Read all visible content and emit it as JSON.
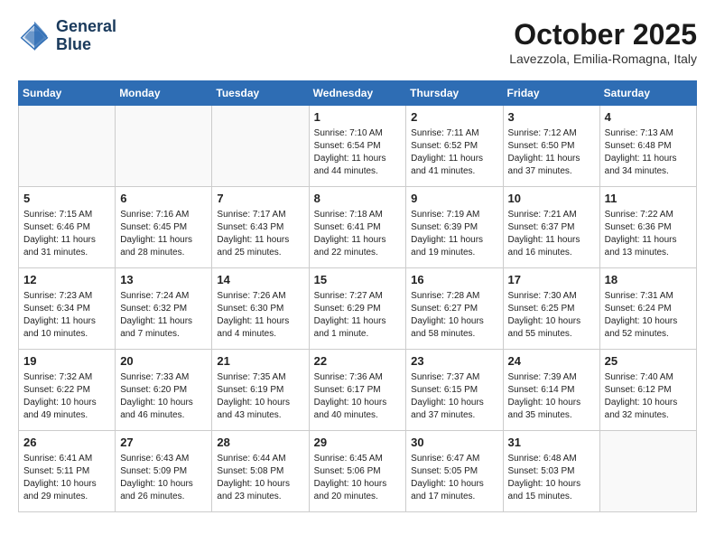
{
  "header": {
    "logo_line1": "General",
    "logo_line2": "Blue",
    "month_title": "October 2025",
    "location": "Lavezzola, Emilia-Romagna, Italy"
  },
  "days_of_week": [
    "Sunday",
    "Monday",
    "Tuesday",
    "Wednesday",
    "Thursday",
    "Friday",
    "Saturday"
  ],
  "weeks": [
    [
      {
        "day": "",
        "info": ""
      },
      {
        "day": "",
        "info": ""
      },
      {
        "day": "",
        "info": ""
      },
      {
        "day": "1",
        "info": "Sunrise: 7:10 AM\nSunset: 6:54 PM\nDaylight: 11 hours and 44 minutes."
      },
      {
        "day": "2",
        "info": "Sunrise: 7:11 AM\nSunset: 6:52 PM\nDaylight: 11 hours and 41 minutes."
      },
      {
        "day": "3",
        "info": "Sunrise: 7:12 AM\nSunset: 6:50 PM\nDaylight: 11 hours and 37 minutes."
      },
      {
        "day": "4",
        "info": "Sunrise: 7:13 AM\nSunset: 6:48 PM\nDaylight: 11 hours and 34 minutes."
      }
    ],
    [
      {
        "day": "5",
        "info": "Sunrise: 7:15 AM\nSunset: 6:46 PM\nDaylight: 11 hours and 31 minutes."
      },
      {
        "day": "6",
        "info": "Sunrise: 7:16 AM\nSunset: 6:45 PM\nDaylight: 11 hours and 28 minutes."
      },
      {
        "day": "7",
        "info": "Sunrise: 7:17 AM\nSunset: 6:43 PM\nDaylight: 11 hours and 25 minutes."
      },
      {
        "day": "8",
        "info": "Sunrise: 7:18 AM\nSunset: 6:41 PM\nDaylight: 11 hours and 22 minutes."
      },
      {
        "day": "9",
        "info": "Sunrise: 7:19 AM\nSunset: 6:39 PM\nDaylight: 11 hours and 19 minutes."
      },
      {
        "day": "10",
        "info": "Sunrise: 7:21 AM\nSunset: 6:37 PM\nDaylight: 11 hours and 16 minutes."
      },
      {
        "day": "11",
        "info": "Sunrise: 7:22 AM\nSunset: 6:36 PM\nDaylight: 11 hours and 13 minutes."
      }
    ],
    [
      {
        "day": "12",
        "info": "Sunrise: 7:23 AM\nSunset: 6:34 PM\nDaylight: 11 hours and 10 minutes."
      },
      {
        "day": "13",
        "info": "Sunrise: 7:24 AM\nSunset: 6:32 PM\nDaylight: 11 hours and 7 minutes."
      },
      {
        "day": "14",
        "info": "Sunrise: 7:26 AM\nSunset: 6:30 PM\nDaylight: 11 hours and 4 minutes."
      },
      {
        "day": "15",
        "info": "Sunrise: 7:27 AM\nSunset: 6:29 PM\nDaylight: 11 hours and 1 minute."
      },
      {
        "day": "16",
        "info": "Sunrise: 7:28 AM\nSunset: 6:27 PM\nDaylight: 10 hours and 58 minutes."
      },
      {
        "day": "17",
        "info": "Sunrise: 7:30 AM\nSunset: 6:25 PM\nDaylight: 10 hours and 55 minutes."
      },
      {
        "day": "18",
        "info": "Sunrise: 7:31 AM\nSunset: 6:24 PM\nDaylight: 10 hours and 52 minutes."
      }
    ],
    [
      {
        "day": "19",
        "info": "Sunrise: 7:32 AM\nSunset: 6:22 PM\nDaylight: 10 hours and 49 minutes."
      },
      {
        "day": "20",
        "info": "Sunrise: 7:33 AM\nSunset: 6:20 PM\nDaylight: 10 hours and 46 minutes."
      },
      {
        "day": "21",
        "info": "Sunrise: 7:35 AM\nSunset: 6:19 PM\nDaylight: 10 hours and 43 minutes."
      },
      {
        "day": "22",
        "info": "Sunrise: 7:36 AM\nSunset: 6:17 PM\nDaylight: 10 hours and 40 minutes."
      },
      {
        "day": "23",
        "info": "Sunrise: 7:37 AM\nSunset: 6:15 PM\nDaylight: 10 hours and 37 minutes."
      },
      {
        "day": "24",
        "info": "Sunrise: 7:39 AM\nSunset: 6:14 PM\nDaylight: 10 hours and 35 minutes."
      },
      {
        "day": "25",
        "info": "Sunrise: 7:40 AM\nSunset: 6:12 PM\nDaylight: 10 hours and 32 minutes."
      }
    ],
    [
      {
        "day": "26",
        "info": "Sunrise: 6:41 AM\nSunset: 5:11 PM\nDaylight: 10 hours and 29 minutes."
      },
      {
        "day": "27",
        "info": "Sunrise: 6:43 AM\nSunset: 5:09 PM\nDaylight: 10 hours and 26 minutes."
      },
      {
        "day": "28",
        "info": "Sunrise: 6:44 AM\nSunset: 5:08 PM\nDaylight: 10 hours and 23 minutes."
      },
      {
        "day": "29",
        "info": "Sunrise: 6:45 AM\nSunset: 5:06 PM\nDaylight: 10 hours and 20 minutes."
      },
      {
        "day": "30",
        "info": "Sunrise: 6:47 AM\nSunset: 5:05 PM\nDaylight: 10 hours and 17 minutes."
      },
      {
        "day": "31",
        "info": "Sunrise: 6:48 AM\nSunset: 5:03 PM\nDaylight: 10 hours and 15 minutes."
      },
      {
        "day": "",
        "info": ""
      }
    ]
  ]
}
